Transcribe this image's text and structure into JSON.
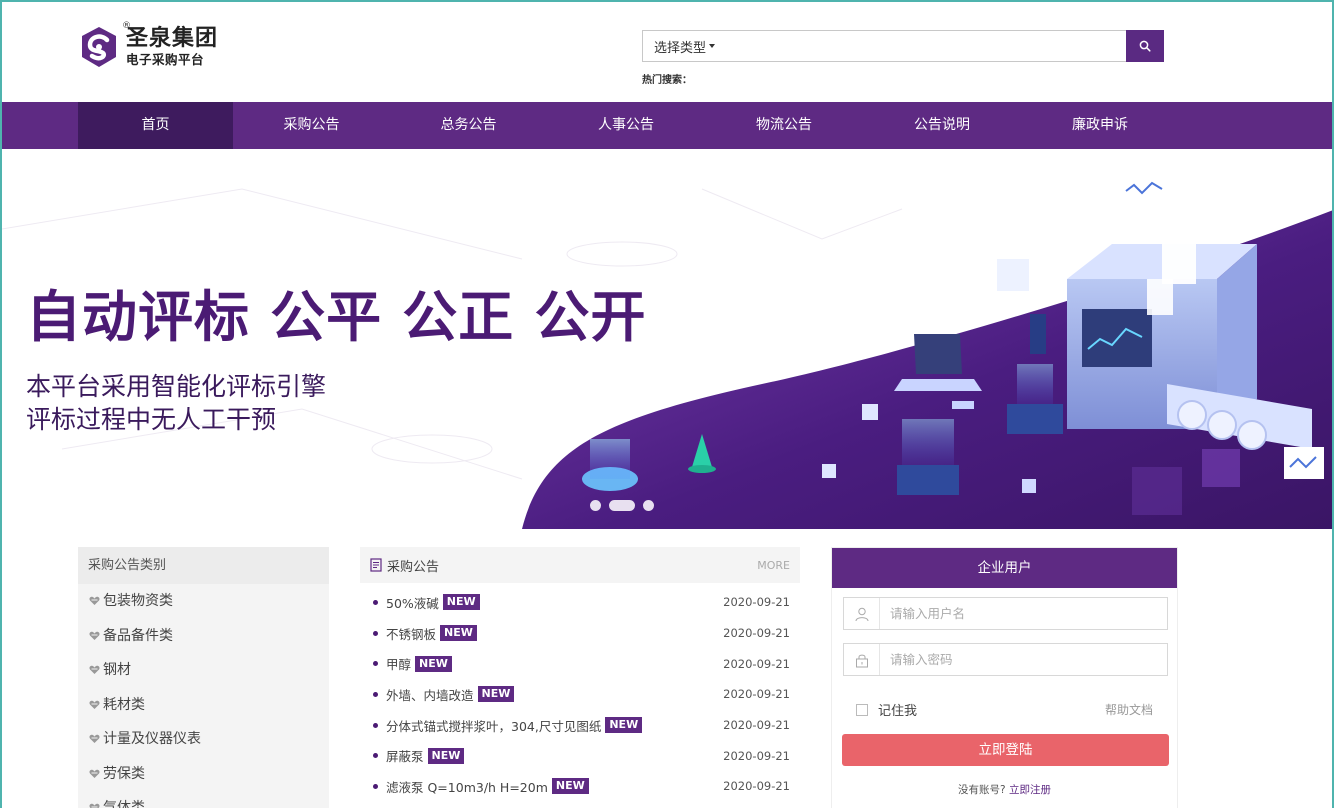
{
  "brand": {
    "name": "圣泉集团",
    "subtitle": "电子采购平台",
    "registered_mark": "®",
    "color": "#5e2a83"
  },
  "search": {
    "type_label": "选择类型",
    "placeholder": "",
    "hot_label": "热门搜索：",
    "icon": "search-icon"
  },
  "nav": {
    "items": [
      {
        "label": "首页",
        "active": true
      },
      {
        "label": "采购公告"
      },
      {
        "label": "总务公告"
      },
      {
        "label": "人事公告"
      },
      {
        "label": "物流公告"
      },
      {
        "label": "公告说明"
      },
      {
        "label": "廉政申诉"
      }
    ]
  },
  "banner": {
    "headline": "自动评标 公平 公正 公开",
    "line1": "本平台采用智能化评标引擎",
    "line2": "评标过程中无人工干预",
    "slide_count": 3,
    "active_slide": 2
  },
  "categories": {
    "title": "采购公告类别",
    "items": [
      "包装物资类",
      "备品备件类",
      "钢材",
      "耗材类",
      "计量及仪器仪表",
      "劳保类",
      "气体类"
    ]
  },
  "news": {
    "title": "采购公告",
    "more_label": "MORE",
    "badge": "NEW",
    "items": [
      {
        "title": "50%液碱",
        "date": "2020-09-21"
      },
      {
        "title": "不锈钢板",
        "date": "2020-09-21"
      },
      {
        "title": "甲醇",
        "date": "2020-09-21"
      },
      {
        "title": "外墙、内墙改造",
        "date": "2020-09-21"
      },
      {
        "title": "分体式锚式搅拌浆叶，304,尺寸见图纸",
        "date": "2020-09-21"
      },
      {
        "title": "屏蔽泵",
        "date": "2020-09-21"
      },
      {
        "title": "滤液泵 Q=10m3/h H=20m",
        "date": "2020-09-21"
      }
    ]
  },
  "login": {
    "title": "企业用户",
    "username_placeholder": "请输入用户名",
    "password_placeholder": "请输入密码",
    "remember_label": "记住我",
    "help_label": "帮助文档",
    "submit_label": "立即登陆",
    "no_account": "没有账号?",
    "register_label": "立即注册",
    "button_color": "#e9646a"
  }
}
